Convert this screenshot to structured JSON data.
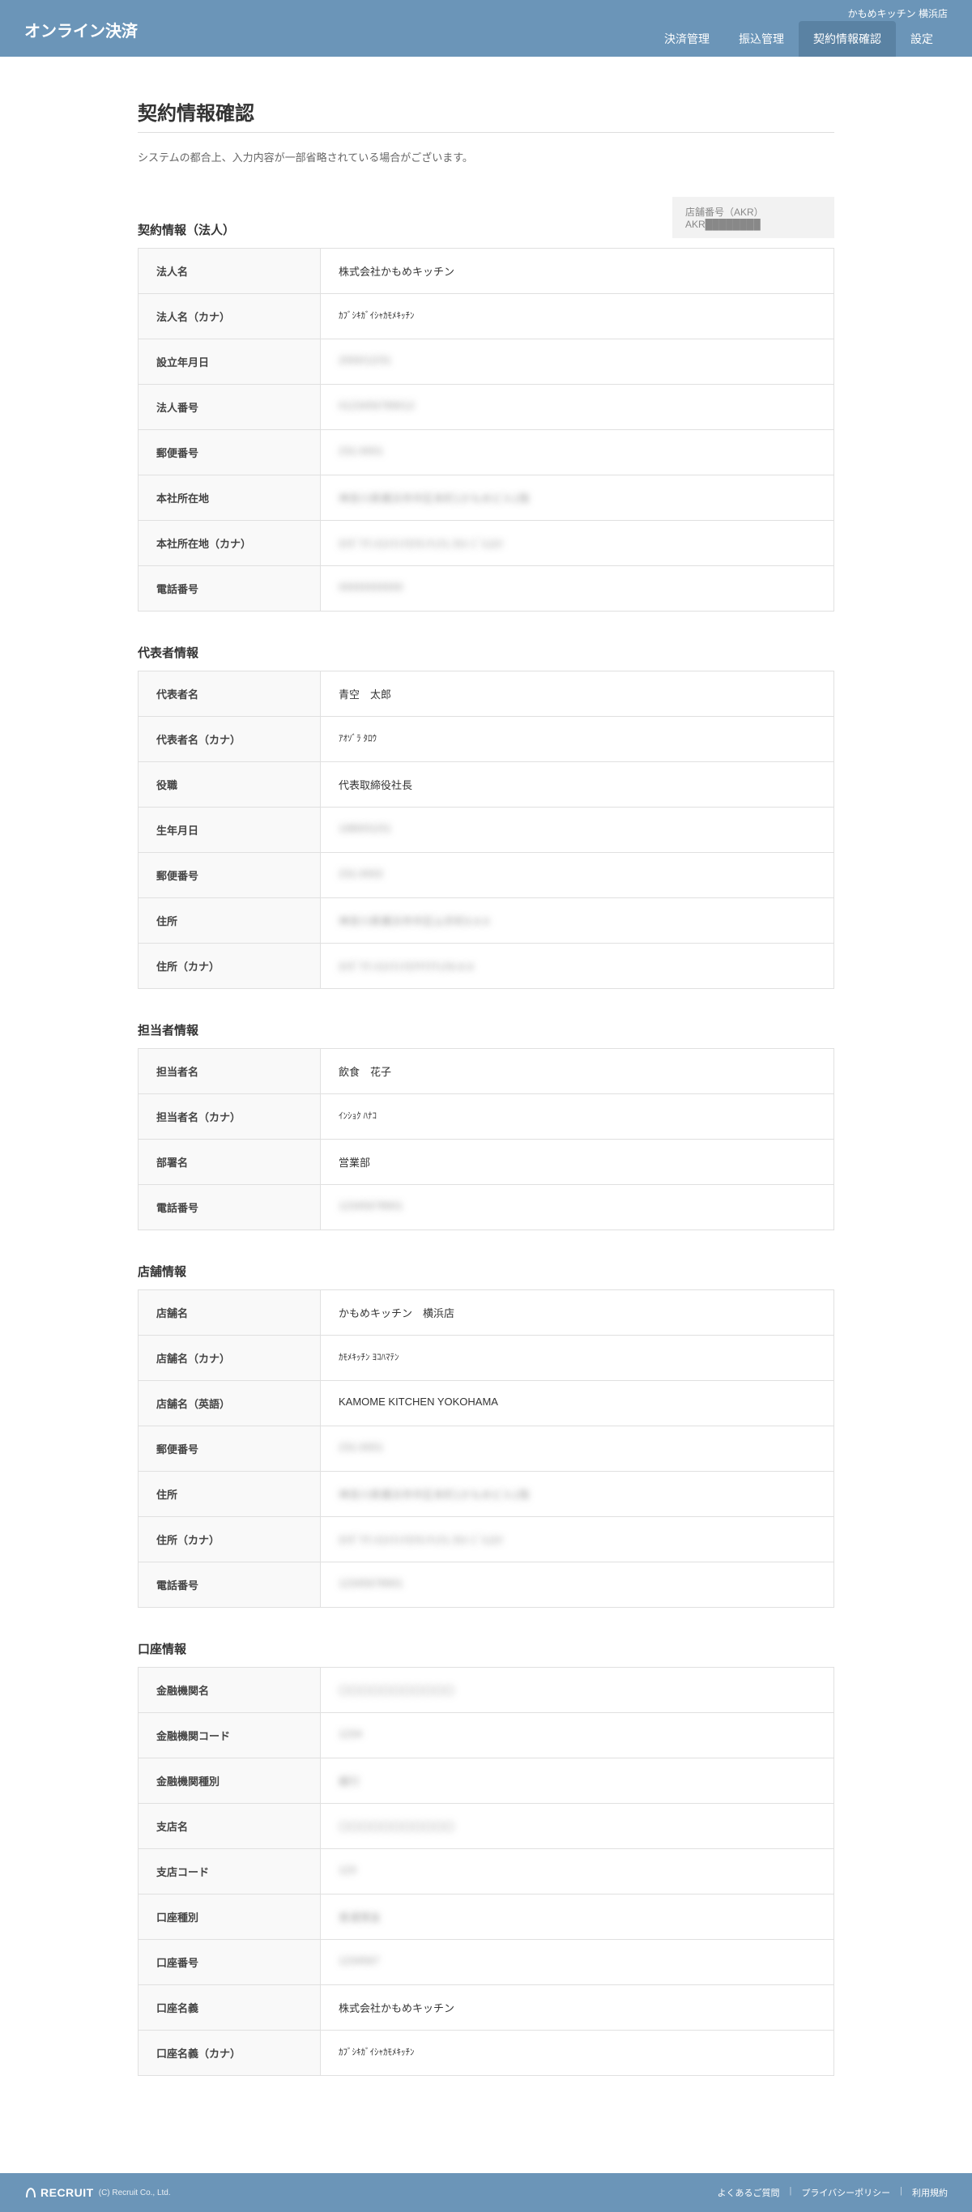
{
  "header": {
    "logo": "オンライン決済",
    "store_name": "かもめキッチン 横浜店",
    "nav": [
      {
        "label": "決済管理",
        "active": false
      },
      {
        "label": "振込管理",
        "active": false
      },
      {
        "label": "契約情報確認",
        "active": true
      },
      {
        "label": "設定",
        "active": false
      }
    ]
  },
  "page": {
    "title": "契約情報確認",
    "description": "システムの都合上、入力内容が一部省略されている場合がございます。"
  },
  "store_badge": {
    "label": "店舗番号（AKR）",
    "value": "AKR████████"
  },
  "sections": {
    "corporate": {
      "title": "契約情報（法人）",
      "rows": [
        {
          "label": "法人名",
          "value": "株式会社かもめキッチン",
          "blurred": false
        },
        {
          "label": "法人名（カナ）",
          "value": "ｶﾌﾞｼｷｶﾞｲｼｬｶﾓﾒｷｯﾁﾝ",
          "blurred": false,
          "small": true
        },
        {
          "label": "設立年月日",
          "value": "2000/12/31",
          "blurred": true
        },
        {
          "label": "法人番号",
          "value": "0123456789012",
          "blurred": true
        },
        {
          "label": "郵便番号",
          "value": "231-0001",
          "blurred": true
        },
        {
          "label": "本社所在地",
          "value": "神奈川県横浜市中区本町1かもめビル1階",
          "blurred": true
        },
        {
          "label": "本社所在地（カナ）",
          "value": "ｶﾅｶﾞﾜｹﾝﾖｺﾊﾏｼﾅｶｸﾎﾝﾁｮｳ1 ｶﾓﾒ ﾋﾞﾙ1ｶｲ",
          "blurred": true
        },
        {
          "label": "電話番号",
          "value": "00000000000",
          "blurred": true
        }
      ]
    },
    "representative": {
      "title": "代表者情報",
      "rows": [
        {
          "label": "代表者名",
          "value": "青空　太郎",
          "blurred": false
        },
        {
          "label": "代表者名（カナ）",
          "value": "ｱｵｿﾞﾗ ﾀﾛｳ",
          "blurred": false,
          "small": true
        },
        {
          "label": "役職",
          "value": "代表取締役社長",
          "blurred": false
        },
        {
          "label": "生年月日",
          "value": "1980/01/01",
          "blurred": true
        },
        {
          "label": "郵便番号",
          "value": "231-0002",
          "blurred": true
        },
        {
          "label": "住所",
          "value": "神奈川県横浜市中区山手町0-0-0",
          "blurred": true
        },
        {
          "label": "住所（カナ）",
          "value": "ｶﾅｶﾞﾜｹﾝﾖｺﾊﾏｼﾅｶｸﾔﾏﾃﾁｮｳ0-0-0",
          "blurred": true
        }
      ]
    },
    "contact": {
      "title": "担当者情報",
      "rows": [
        {
          "label": "担当者名",
          "value": "飲食　花子",
          "blurred": false
        },
        {
          "label": "担当者名（カナ）",
          "value": "ｲﾝｼｮｸ ﾊﾅｺ",
          "blurred": false,
          "small": true
        },
        {
          "label": "部署名",
          "value": "営業部",
          "blurred": false
        },
        {
          "label": "電話番号",
          "value": "12345678901",
          "blurred": true
        }
      ]
    },
    "store": {
      "title": "店舗情報",
      "rows": [
        {
          "label": "店舗名",
          "value": "かもめキッチン　横浜店",
          "blurred": false
        },
        {
          "label": "店舗名（カナ）",
          "value": "ｶﾓﾒｷｯﾁﾝ ﾖｺﾊﾏﾃﾝ",
          "blurred": false,
          "small": true
        },
        {
          "label": "店舗名（英語）",
          "value": "KAMOME KITCHEN YOKOHAMA",
          "blurred": false
        },
        {
          "label": "郵便番号",
          "value": "231-0001",
          "blurred": true
        },
        {
          "label": "住所",
          "value": "神奈川県横浜市中区本町1かもめビル1階",
          "blurred": true
        },
        {
          "label": "住所（カナ）",
          "value": "ｶﾅｶﾞﾜｹﾝﾖｺﾊﾏｼﾅｶｸﾎﾝﾁｮｳ1 ｶﾓﾒ ﾋﾞﾙ1ｶｲ",
          "blurred": true
        },
        {
          "label": "電話番号",
          "value": "12345678901",
          "blurred": true
        }
      ]
    },
    "account": {
      "title": "口座情報",
      "rows": [
        {
          "label": "金融機関名",
          "value": "〇〇〇〇〇〇〇〇〇〇〇",
          "blurred": true
        },
        {
          "label": "金融機関コード",
          "value": "1234",
          "blurred": true
        },
        {
          "label": "金融機関種別",
          "value": "銀行",
          "blurred": true
        },
        {
          "label": "支店名",
          "value": "〇〇〇〇〇〇〇〇〇〇〇",
          "blurred": true
        },
        {
          "label": "支店コード",
          "value": "123",
          "blurred": true
        },
        {
          "label": "口座種別",
          "value": "普通預金",
          "blurred": true
        },
        {
          "label": "口座番号",
          "value": "1234567",
          "blurred": true
        },
        {
          "label": "口座名義",
          "value": "株式会社かもめキッチン",
          "blurred": false
        },
        {
          "label": "口座名義（カナ）",
          "value": "ｶﾌﾞｼｷｶﾞｲｼｬｶﾓﾒｷｯﾁﾝ",
          "blurred": false,
          "small": true
        }
      ]
    }
  },
  "footer": {
    "brand": "RECRUIT",
    "copyright": "(C) Recruit Co., Ltd.",
    "links": [
      "よくあるご質問",
      "プライバシーポリシー",
      "利用規約"
    ]
  }
}
